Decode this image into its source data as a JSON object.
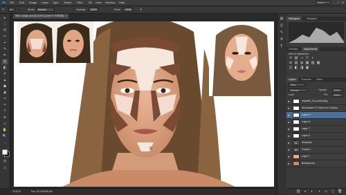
{
  "app": {
    "logo": "Ps"
  },
  "menu": [
    "File",
    "Edit",
    "Image",
    "Layer",
    "Type",
    "Select",
    "Filter",
    "3D",
    "View",
    "Window",
    "Help"
  ],
  "workspace": "Default",
  "window_controls": [
    "–",
    "□",
    "✕"
  ],
  "options": {
    "mode_label": "Mode:",
    "mode_value": "Normal",
    "opacity_label": "Opacity:",
    "opacity_value": "100%",
    "flow_label": "Flow:",
    "flow_value": "100%"
  },
  "document": {
    "tab_title": "Will-4 Jargin.psd @ 16.5% (Laser 9, RGB/8#)",
    "close": "×"
  },
  "status": {
    "zoom": "16.67%",
    "doc": "Doc: 60.1M/365.4M"
  },
  "panels": {
    "top_tabs": [
      "Histogram",
      "Navigator"
    ],
    "adj_tabs": [
      "Libraries",
      "Adjustments"
    ],
    "adj_title": "Add an adjustment",
    "adj_icons": [
      "☀",
      "▥",
      "◑",
      "▽",
      "◐",
      "⚖",
      "▤",
      "◍",
      "▦",
      "▨",
      "▩",
      "◫",
      "◧",
      "◨",
      "▣"
    ],
    "layer_tabs": [
      "Layers",
      "Channels",
      "Paths"
    ],
    "layer_kind": "Kind",
    "blend_mode": "Normal",
    "layer_opacity_label": "Opacity:",
    "layer_opacity": "100%",
    "lock_label": "Lock:",
    "fill_label": "Fill:",
    "fill_value": "100%",
    "layers": [
      {
        "name": "marathe_16_contouring",
        "visible": "👁",
        "active": false
      },
      {
        "name": "Shockwave TV Video for Contour...",
        "visible": "👁",
        "active": false
      },
      {
        "name": "Layer 9",
        "visible": "👁",
        "active": true
      },
      {
        "name": "Layer 8",
        "visible": "👁",
        "active": false
      },
      {
        "name": "Layer 7",
        "visible": "👁",
        "active": false
      },
      {
        "name": "Layer 6",
        "visible": "👁",
        "active": false
      },
      {
        "name": "Shadows",
        "visible": "👁",
        "active": false
      },
      {
        "name": "Group 1",
        "visible": "👁",
        "active": false
      },
      {
        "name": "Layer 1",
        "visible": "👁",
        "active": false
      },
      {
        "name": "Background",
        "visible": "👁",
        "active": false
      }
    ],
    "bottom_icons": [
      "⛓",
      "fx",
      "◐",
      "◑",
      "▭",
      "▢",
      "🗑"
    ]
  },
  "tools": [
    "▸",
    "⬚",
    "ʘ",
    "✂",
    "⌖",
    "✎",
    "✒",
    "⎚",
    "◧",
    "✐",
    "▲",
    "☗",
    "◉",
    "✑",
    "T",
    "➤",
    "▭",
    "✋",
    "🔍",
    "…"
  ],
  "colors": {
    "accent": "#4e6e95",
    "skin": "#e4ad8d",
    "contour": "#7a4a35",
    "highlight": "#f6e6dc",
    "hair": "#6a4a2e"
  }
}
